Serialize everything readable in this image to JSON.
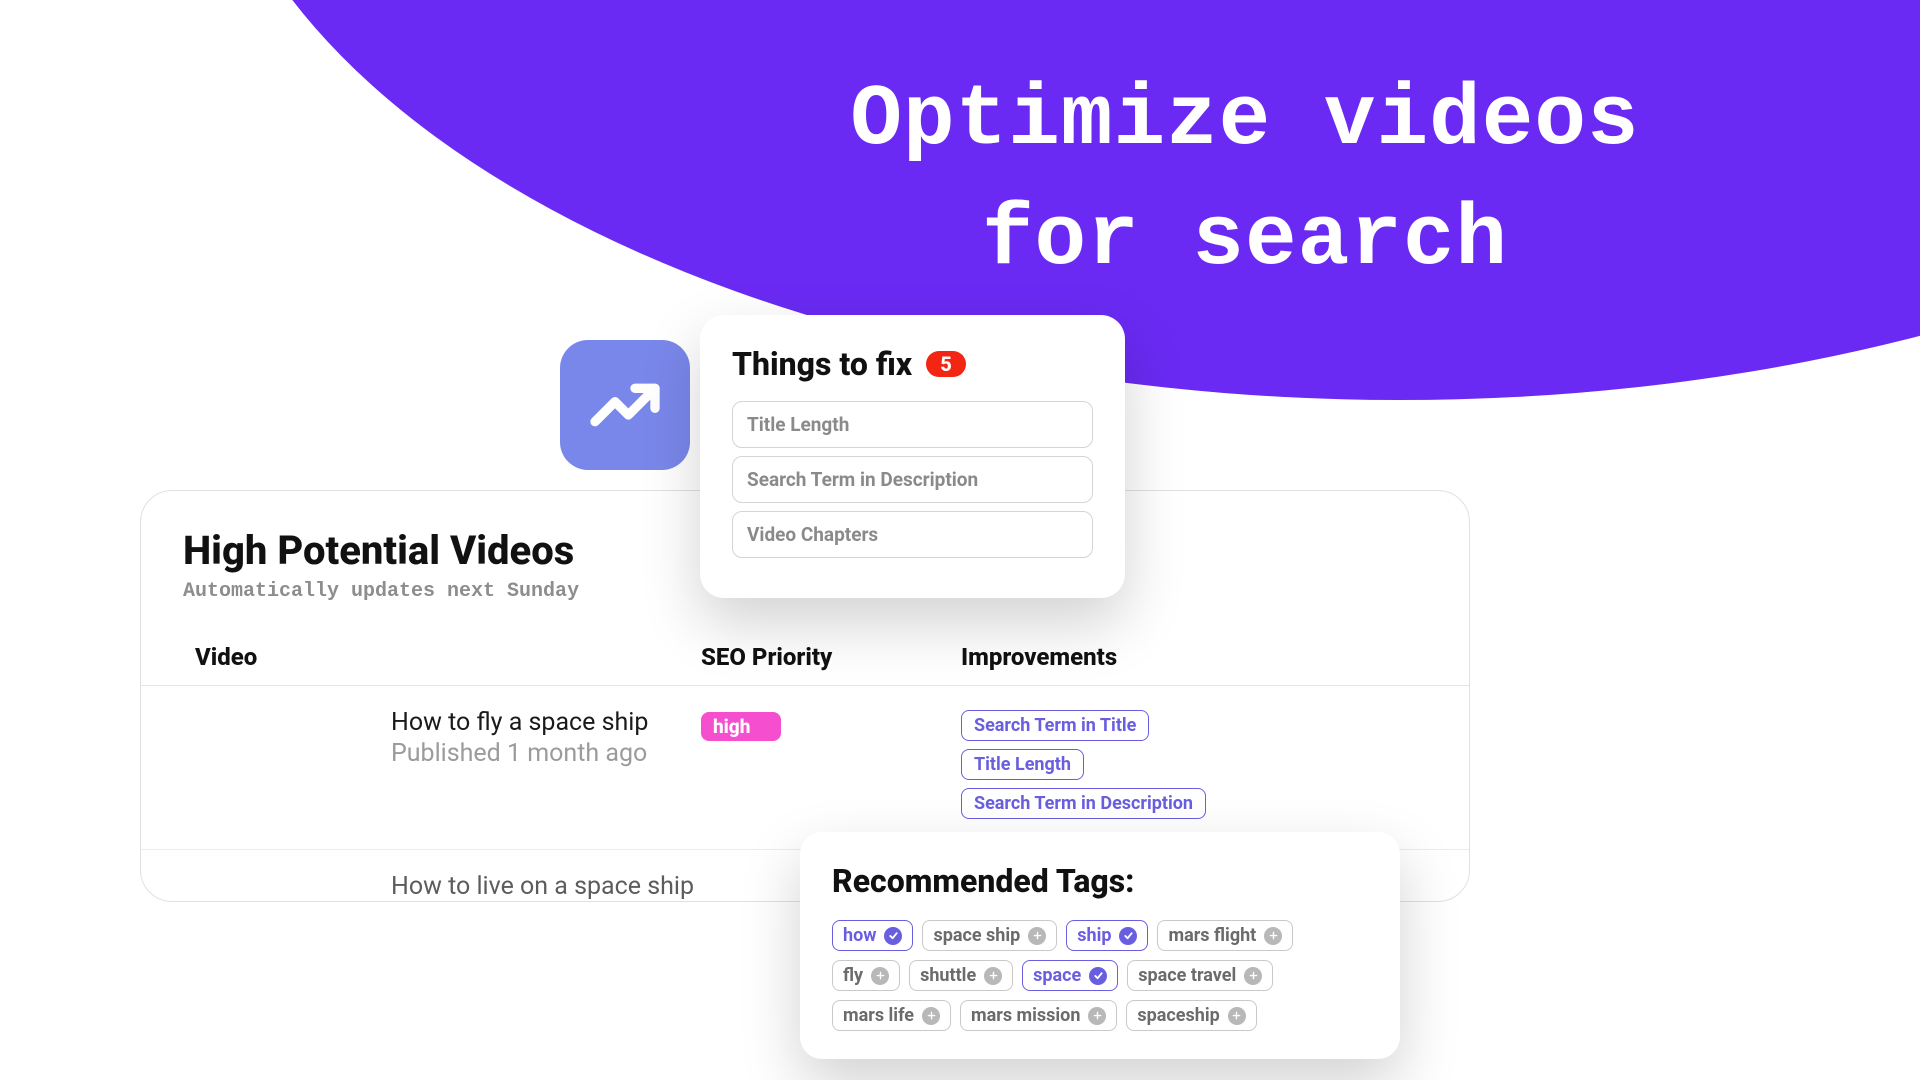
{
  "hero": {
    "title_line1": "Optimize videos",
    "title_line2": "for search"
  },
  "things_to_fix": {
    "title": "Things to fix",
    "count": "5",
    "items": [
      "Title Length",
      "Search Term in Description",
      "Video Chapters"
    ]
  },
  "high_potential": {
    "title": "High Potential Videos",
    "subtitle": "Automatically updates next Sunday",
    "columns": {
      "video": "Video",
      "seo": "SEO Priority",
      "imp": "Improvements"
    },
    "rows": [
      {
        "title": "How to fly a space ship",
        "published": "Published 1 month ago",
        "priority": "high",
        "improvements": [
          "Search Term in Title",
          "Title Length",
          "Search Term in Description"
        ]
      },
      {
        "title": "How to live on a space ship",
        "published": "",
        "priority": "",
        "improvements": []
      }
    ]
  },
  "recommended_tags": {
    "title": "Recommended Tags:",
    "tags": [
      {
        "label": "how",
        "selected": true
      },
      {
        "label": "space ship",
        "selected": false
      },
      {
        "label": "ship",
        "selected": true
      },
      {
        "label": "mars flight",
        "selected": false
      },
      {
        "label": "fly",
        "selected": false
      },
      {
        "label": "shuttle",
        "selected": false
      },
      {
        "label": "space",
        "selected": true
      },
      {
        "label": "space travel",
        "selected": false
      },
      {
        "label": "mars life",
        "selected": false
      },
      {
        "label": "mars mission",
        "selected": false
      },
      {
        "label": "spaceship",
        "selected": false
      }
    ]
  }
}
